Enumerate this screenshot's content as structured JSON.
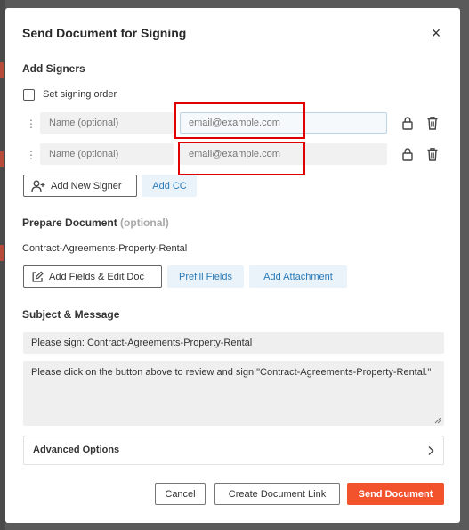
{
  "modal": {
    "title": "Send Document for Signing",
    "close_glyph": "×"
  },
  "signers_section": {
    "heading": "Add Signers",
    "signing_order_label": "Set signing order",
    "signing_order_checked": false,
    "signers": [
      {
        "name_placeholder": "Name (optional)",
        "email_placeholder": "email@example.com",
        "email_value": ""
      },
      {
        "name_placeholder": "Name (optional)",
        "email_placeholder": "email@example.com",
        "email_value": ""
      }
    ],
    "add_signer_label": "Add New Signer",
    "add_cc_label": "Add CC"
  },
  "prepare_section": {
    "heading": "Prepare Document",
    "optional_label": "(optional)",
    "document_name": "Contract-Agreements-Property-Rental",
    "add_fields_label": "Add Fields & Edit Doc",
    "prefill_label": "Prefill Fields",
    "attachment_label": "Add Attachment"
  },
  "message_section": {
    "heading": "Subject & Message",
    "subject_value": "Please sign: Contract-Agreements-Property-Rental",
    "message_value": "Please click on the button above to review and sign \"Contract-Agreements-Property-Rental.\""
  },
  "advanced": {
    "label": "Advanced Options"
  },
  "footer": {
    "cancel_label": "Cancel",
    "create_link_label": "Create Document Link",
    "send_label": "Send Document"
  },
  "colors": {
    "primary_action": "#f2522c",
    "link_blue": "#2a7ab8",
    "highlight_box": "#e00000"
  },
  "icons": [
    "drag-handle-icon",
    "lock-icon",
    "trash-icon",
    "add-user-icon",
    "edit-icon",
    "chevron-right-icon",
    "close-icon"
  ]
}
